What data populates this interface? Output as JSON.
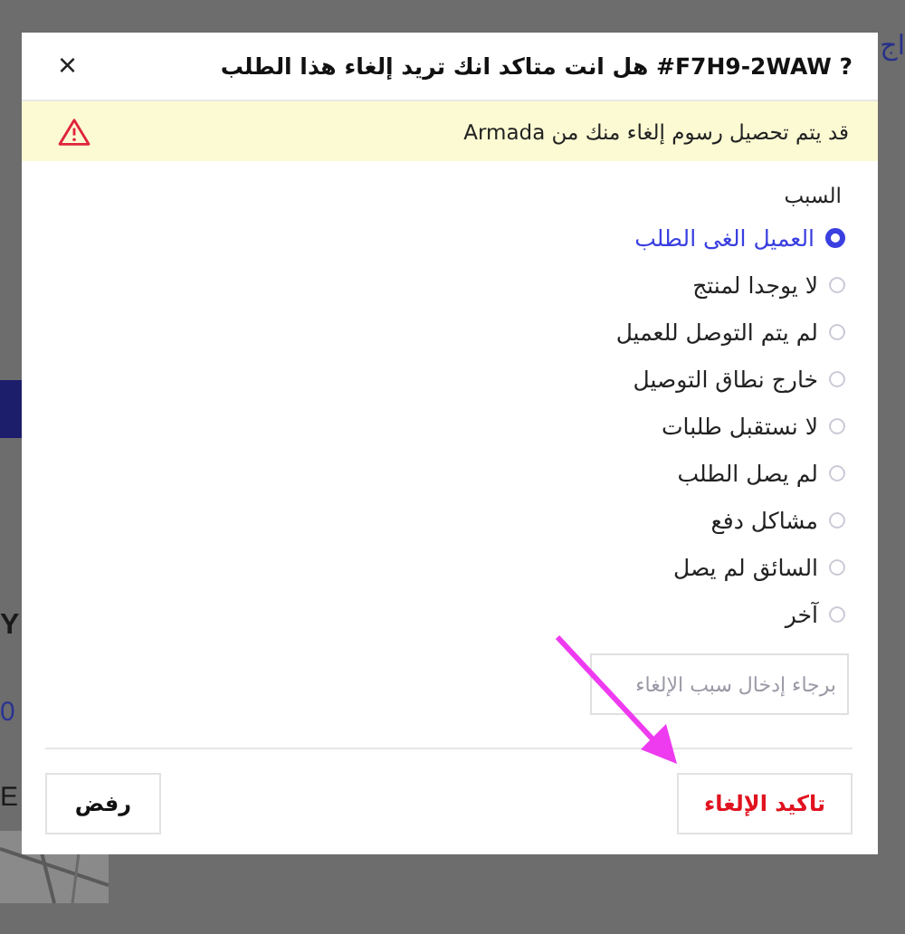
{
  "background": {
    "fragments": [
      {
        "text": "Y",
        "kind": "bold"
      },
      {
        "text": "0",
        "kind": "link"
      },
      {
        "text": "E",
        "kind": "plain"
      }
    ],
    "corner_text": "اج"
  },
  "dialog": {
    "title": "? F7H9-2WAW# هل انت متاكد انك تريد إلغاء هذا الطلب",
    "close": "×",
    "warning": "قد يتم تحصيل رسوم إلغاء منك من Armada",
    "reason_label": "السبب",
    "reasons": [
      {
        "label": "العميل الغى الطلب",
        "selected": true
      },
      {
        "label": "لا يوجدا لمنتج",
        "selected": false
      },
      {
        "label": "لم يتم التوصل للعميل",
        "selected": false
      },
      {
        "label": "خارج نطاق التوصيل",
        "selected": false
      },
      {
        "label": "لا نستقبل طلبات",
        "selected": false
      },
      {
        "label": "لم يصل الطلب",
        "selected": false
      },
      {
        "label": "مشاكل دفع",
        "selected": false
      },
      {
        "label": "السائق لم يصل",
        "selected": false
      },
      {
        "label": "آخر",
        "selected": false
      }
    ],
    "reason_input": {
      "placeholder": "برجاء إدخال سبب الإلغاء"
    },
    "buttons": [
      {
        "label": "تاكيد الإلغاء",
        "kind": "danger"
      },
      {
        "label": "رفض",
        "kind": "plain"
      }
    ]
  }
}
